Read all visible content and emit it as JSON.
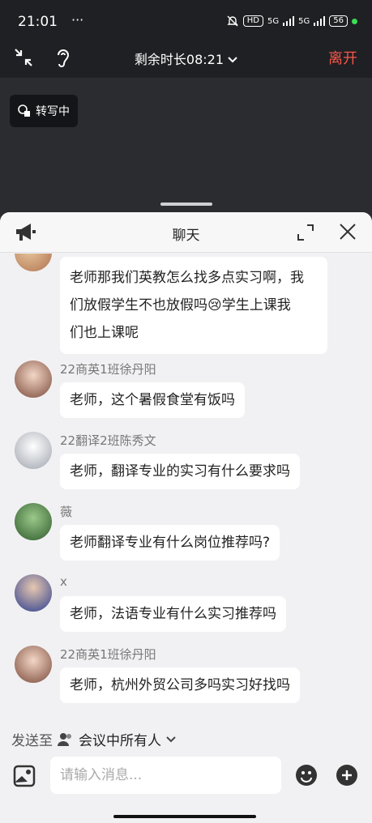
{
  "status_bar": {
    "time": "21:01",
    "dots": "···",
    "network_1": "5G",
    "network_2": "5G",
    "hd": "HD",
    "battery": "56"
  },
  "meeting": {
    "remaining": "剩余时长08:21",
    "leave": "离开",
    "transcribe": "转写中"
  },
  "chat": {
    "title": "聊天",
    "messages": [
      {
        "sender": "",
        "text_lines": [
          "老师那我们英教怎么找多点实习啊，我",
          "们放假学生不也放假吗😢学生上课我",
          "们也上课呢"
        ]
      },
      {
        "sender": "22商英1班徐丹阳",
        "text": "老师，这个暑假食堂有饭吗"
      },
      {
        "sender": "22翻译2班陈秀文",
        "text": "老师，翻译专业的实习有什么要求吗"
      },
      {
        "sender": "薇",
        "text": "老师翻译专业有什么岗位推荐吗?"
      },
      {
        "sender": "x",
        "text": "老师，法语专业有什么实习推荐吗"
      },
      {
        "sender": "22商英1班徐丹阳",
        "text": "老师，杭州外贸公司多吗实习好找吗"
      }
    ],
    "send_to_label": "发送至",
    "send_to_target": "会议中所有人",
    "input_placeholder": "请输入消息..."
  },
  "colors": {
    "leave": "#f5564a",
    "accent_green": "#3ddc55"
  }
}
